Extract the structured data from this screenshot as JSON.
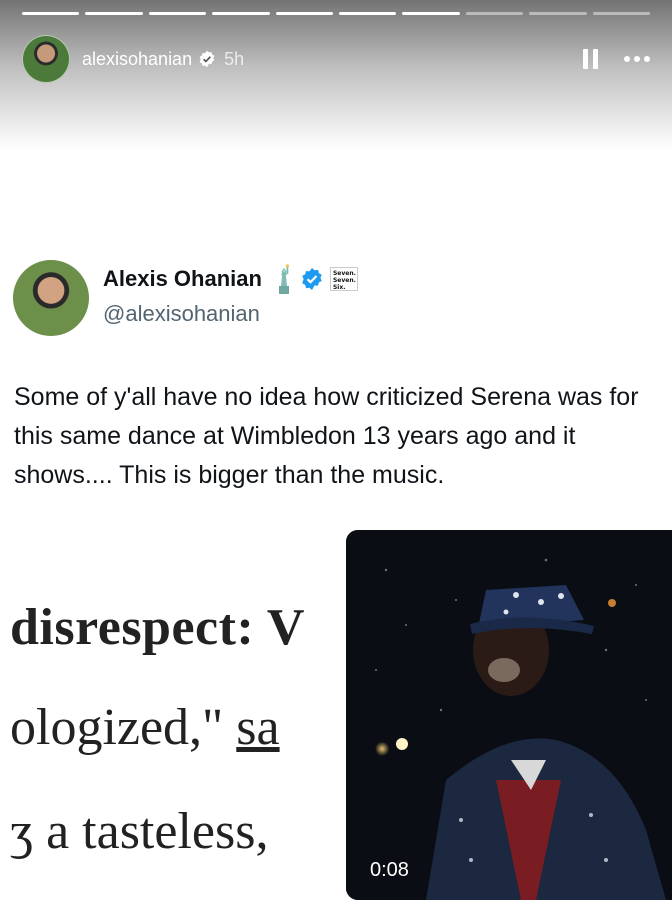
{
  "story": {
    "progress": {
      "total": 10,
      "completed": 7
    },
    "username": "alexisohanian",
    "time": "5h",
    "icons": [
      "verified-icon",
      "pause-icon",
      "more-icon"
    ]
  },
  "tweet": {
    "display_name": "Alexis Ohanian",
    "handle": "@alexisohanian",
    "badge_text": "Seven. Seven. Six.",
    "text": "Some of y'all have no idea how criticized Serena was for this same dance at Wimbledon 13 years ago and it shows.... This is bigger than the music."
  },
  "article_snippet": {
    "line1": "disrespect: V",
    "line2a": "ologized,\" ",
    "line2b": "sa",
    "line3": "ʒ a tasteless,"
  },
  "video": {
    "timestamp": "0:08"
  },
  "colors": {
    "verified": "#1d9bf0",
    "text_primary": "#0f1419",
    "text_secondary": "#536471"
  }
}
